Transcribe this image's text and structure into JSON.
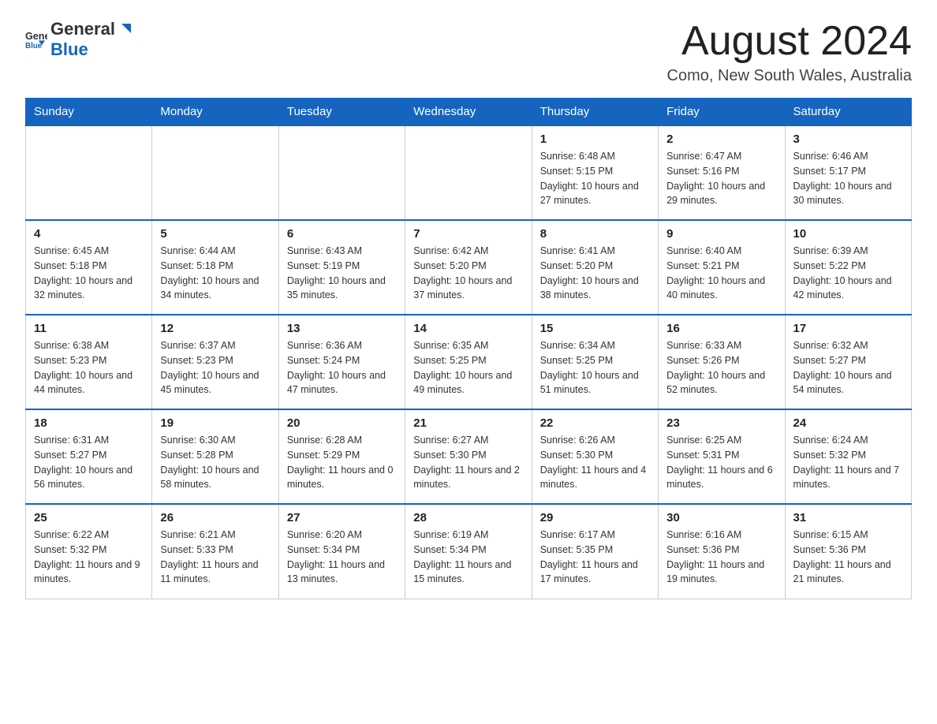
{
  "header": {
    "logo": {
      "text_general": "General",
      "text_blue": "Blue",
      "logo_alt": "GeneralBlue Logo"
    },
    "title": "August 2024",
    "location": "Como, New South Wales, Australia"
  },
  "calendar": {
    "days_of_week": [
      "Sunday",
      "Monday",
      "Tuesday",
      "Wednesday",
      "Thursday",
      "Friday",
      "Saturday"
    ],
    "weeks": [
      [
        {
          "day": "",
          "info": ""
        },
        {
          "day": "",
          "info": ""
        },
        {
          "day": "",
          "info": ""
        },
        {
          "day": "",
          "info": ""
        },
        {
          "day": "1",
          "info": "Sunrise: 6:48 AM\nSunset: 5:15 PM\nDaylight: 10 hours and 27 minutes."
        },
        {
          "day": "2",
          "info": "Sunrise: 6:47 AM\nSunset: 5:16 PM\nDaylight: 10 hours and 29 minutes."
        },
        {
          "day": "3",
          "info": "Sunrise: 6:46 AM\nSunset: 5:17 PM\nDaylight: 10 hours and 30 minutes."
        }
      ],
      [
        {
          "day": "4",
          "info": "Sunrise: 6:45 AM\nSunset: 5:18 PM\nDaylight: 10 hours and 32 minutes."
        },
        {
          "day": "5",
          "info": "Sunrise: 6:44 AM\nSunset: 5:18 PM\nDaylight: 10 hours and 34 minutes."
        },
        {
          "day": "6",
          "info": "Sunrise: 6:43 AM\nSunset: 5:19 PM\nDaylight: 10 hours and 35 minutes."
        },
        {
          "day": "7",
          "info": "Sunrise: 6:42 AM\nSunset: 5:20 PM\nDaylight: 10 hours and 37 minutes."
        },
        {
          "day": "8",
          "info": "Sunrise: 6:41 AM\nSunset: 5:20 PM\nDaylight: 10 hours and 38 minutes."
        },
        {
          "day": "9",
          "info": "Sunrise: 6:40 AM\nSunset: 5:21 PM\nDaylight: 10 hours and 40 minutes."
        },
        {
          "day": "10",
          "info": "Sunrise: 6:39 AM\nSunset: 5:22 PM\nDaylight: 10 hours and 42 minutes."
        }
      ],
      [
        {
          "day": "11",
          "info": "Sunrise: 6:38 AM\nSunset: 5:23 PM\nDaylight: 10 hours and 44 minutes."
        },
        {
          "day": "12",
          "info": "Sunrise: 6:37 AM\nSunset: 5:23 PM\nDaylight: 10 hours and 45 minutes."
        },
        {
          "day": "13",
          "info": "Sunrise: 6:36 AM\nSunset: 5:24 PM\nDaylight: 10 hours and 47 minutes."
        },
        {
          "day": "14",
          "info": "Sunrise: 6:35 AM\nSunset: 5:25 PM\nDaylight: 10 hours and 49 minutes."
        },
        {
          "day": "15",
          "info": "Sunrise: 6:34 AM\nSunset: 5:25 PM\nDaylight: 10 hours and 51 minutes."
        },
        {
          "day": "16",
          "info": "Sunrise: 6:33 AM\nSunset: 5:26 PM\nDaylight: 10 hours and 52 minutes."
        },
        {
          "day": "17",
          "info": "Sunrise: 6:32 AM\nSunset: 5:27 PM\nDaylight: 10 hours and 54 minutes."
        }
      ],
      [
        {
          "day": "18",
          "info": "Sunrise: 6:31 AM\nSunset: 5:27 PM\nDaylight: 10 hours and 56 minutes."
        },
        {
          "day": "19",
          "info": "Sunrise: 6:30 AM\nSunset: 5:28 PM\nDaylight: 10 hours and 58 minutes."
        },
        {
          "day": "20",
          "info": "Sunrise: 6:28 AM\nSunset: 5:29 PM\nDaylight: 11 hours and 0 minutes."
        },
        {
          "day": "21",
          "info": "Sunrise: 6:27 AM\nSunset: 5:30 PM\nDaylight: 11 hours and 2 minutes."
        },
        {
          "day": "22",
          "info": "Sunrise: 6:26 AM\nSunset: 5:30 PM\nDaylight: 11 hours and 4 minutes."
        },
        {
          "day": "23",
          "info": "Sunrise: 6:25 AM\nSunset: 5:31 PM\nDaylight: 11 hours and 6 minutes."
        },
        {
          "day": "24",
          "info": "Sunrise: 6:24 AM\nSunset: 5:32 PM\nDaylight: 11 hours and 7 minutes."
        }
      ],
      [
        {
          "day": "25",
          "info": "Sunrise: 6:22 AM\nSunset: 5:32 PM\nDaylight: 11 hours and 9 minutes."
        },
        {
          "day": "26",
          "info": "Sunrise: 6:21 AM\nSunset: 5:33 PM\nDaylight: 11 hours and 11 minutes."
        },
        {
          "day": "27",
          "info": "Sunrise: 6:20 AM\nSunset: 5:34 PM\nDaylight: 11 hours and 13 minutes."
        },
        {
          "day": "28",
          "info": "Sunrise: 6:19 AM\nSunset: 5:34 PM\nDaylight: 11 hours and 15 minutes."
        },
        {
          "day": "29",
          "info": "Sunrise: 6:17 AM\nSunset: 5:35 PM\nDaylight: 11 hours and 17 minutes."
        },
        {
          "day": "30",
          "info": "Sunrise: 6:16 AM\nSunset: 5:36 PM\nDaylight: 11 hours and 19 minutes."
        },
        {
          "day": "31",
          "info": "Sunrise: 6:15 AM\nSunset: 5:36 PM\nDaylight: 11 hours and 21 minutes."
        }
      ]
    ]
  }
}
